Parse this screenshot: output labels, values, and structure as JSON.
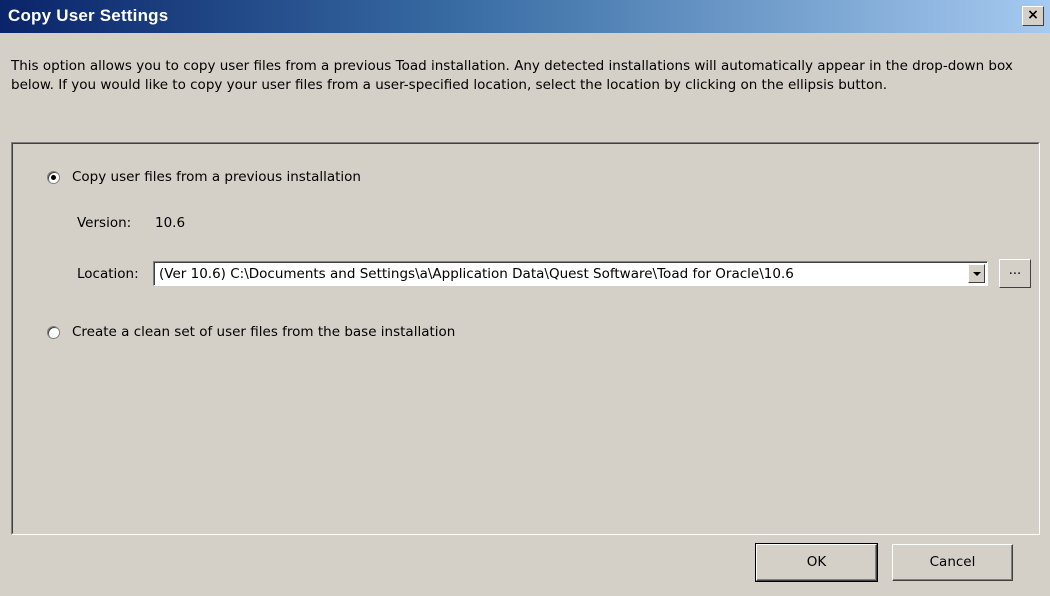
{
  "window": {
    "title": "Copy User Settings",
    "close_label": "×"
  },
  "description": "This option allows you to copy user files from a previous Toad installation.  Any detected installations will automatically appear in the drop-down box below.  If you would like to copy your user files from a user-specified location, select the location by clicking on the ellipsis button.",
  "options": {
    "copy_previous": {
      "label": "Copy user files from a previous installation",
      "selected": true
    },
    "clean_set": {
      "label": "Create a clean set of user files from the base installation",
      "selected": false
    }
  },
  "version": {
    "label": "Version:",
    "value": "10.6"
  },
  "location": {
    "label": "Location:",
    "value": "(Ver 10.6) C:\\Documents and Settings\\a\\Application Data\\Quest Software\\Toad for Oracle\\10.6",
    "browse_label": "..."
  },
  "buttons": {
    "ok": "OK",
    "cancel": "Cancel"
  }
}
